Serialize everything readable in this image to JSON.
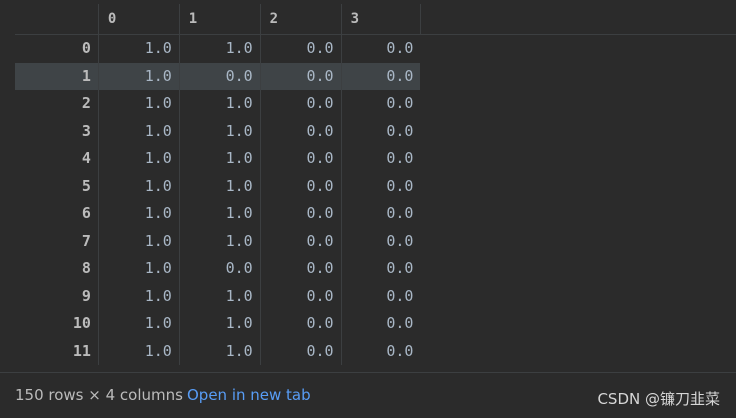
{
  "columns": [
    "0",
    "1",
    "2",
    "3"
  ],
  "rows": [
    {
      "index": "0",
      "cells": [
        "1.0",
        "1.0",
        "0.0",
        "0.0"
      ]
    },
    {
      "index": "1",
      "cells": [
        "1.0",
        "0.0",
        "0.0",
        "0.0"
      ]
    },
    {
      "index": "2",
      "cells": [
        "1.0",
        "1.0",
        "0.0",
        "0.0"
      ]
    },
    {
      "index": "3",
      "cells": [
        "1.0",
        "1.0",
        "0.0",
        "0.0"
      ]
    },
    {
      "index": "4",
      "cells": [
        "1.0",
        "1.0",
        "0.0",
        "0.0"
      ]
    },
    {
      "index": "5",
      "cells": [
        "1.0",
        "1.0",
        "0.0",
        "0.0"
      ]
    },
    {
      "index": "6",
      "cells": [
        "1.0",
        "1.0",
        "0.0",
        "0.0"
      ]
    },
    {
      "index": "7",
      "cells": [
        "1.0",
        "1.0",
        "0.0",
        "0.0"
      ]
    },
    {
      "index": "8",
      "cells": [
        "1.0",
        "0.0",
        "0.0",
        "0.0"
      ]
    },
    {
      "index": "9",
      "cells": [
        "1.0",
        "1.0",
        "0.0",
        "0.0"
      ]
    },
    {
      "index": "10",
      "cells": [
        "1.0",
        "1.0",
        "0.0",
        "0.0"
      ]
    },
    {
      "index": "11",
      "cells": [
        "1.0",
        "1.0",
        "0.0",
        "0.0"
      ]
    }
  ],
  "selected_row": "1",
  "footer": {
    "rows_info": "150 rows × 4 columns",
    "open_link": "Open in new tab"
  },
  "watermark": "CSDN @镰刀韭菜",
  "colors": {
    "background": "#2b2b2b",
    "selection": "#3f4447",
    "link": "#589df6"
  }
}
